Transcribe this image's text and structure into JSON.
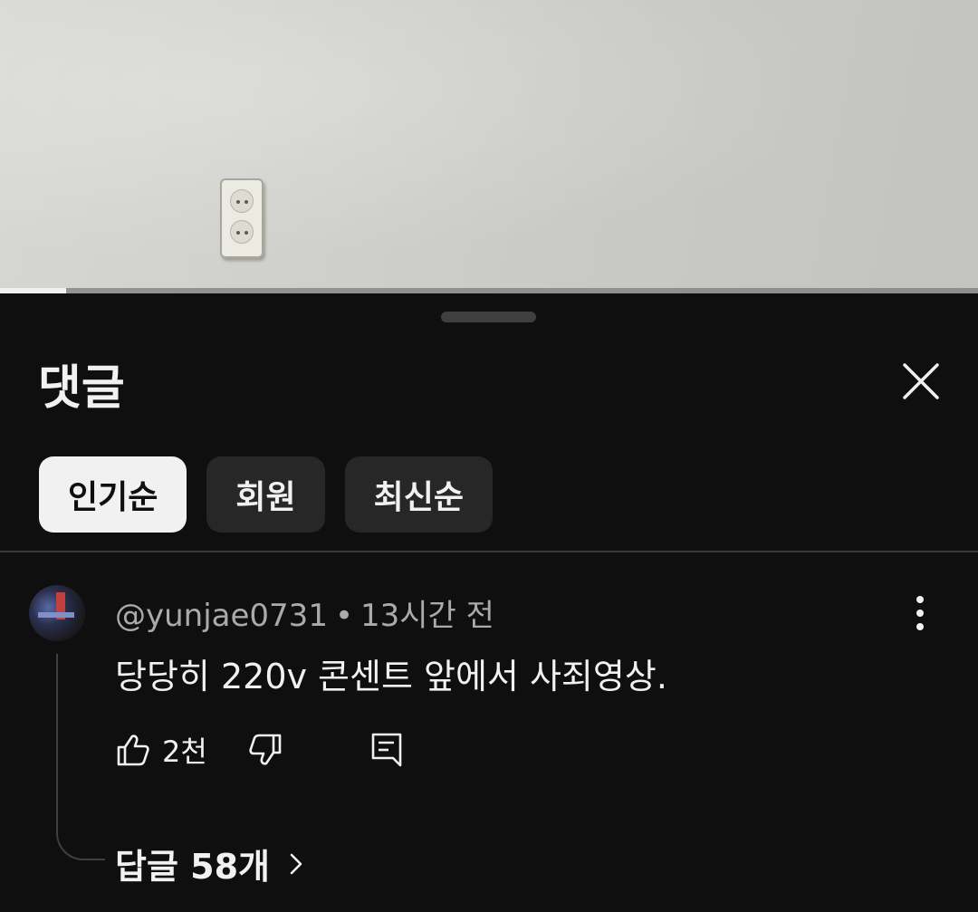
{
  "video": {
    "progress_fraction": 0.068
  },
  "sheet": {
    "title": "댓글",
    "close_icon": "close-icon"
  },
  "sort_chips": [
    {
      "label": "인기순",
      "selected": true
    },
    {
      "label": "회원",
      "selected": false
    },
    {
      "label": "최신순",
      "selected": false
    }
  ],
  "comment": {
    "author": "@yunjae0731",
    "separator": "•",
    "time": "13시간 전",
    "text": "당당히 220v 콘센트 앞에서 사죄영상.",
    "like_count": "2천",
    "replies_label": "답글 58개",
    "more_icon": "more-vert-icon"
  },
  "colors": {
    "background": "#0f0f0f",
    "chip_selected": "#f1f1f1",
    "chip": "#272727",
    "secondary_text": "#aaaaaa"
  }
}
